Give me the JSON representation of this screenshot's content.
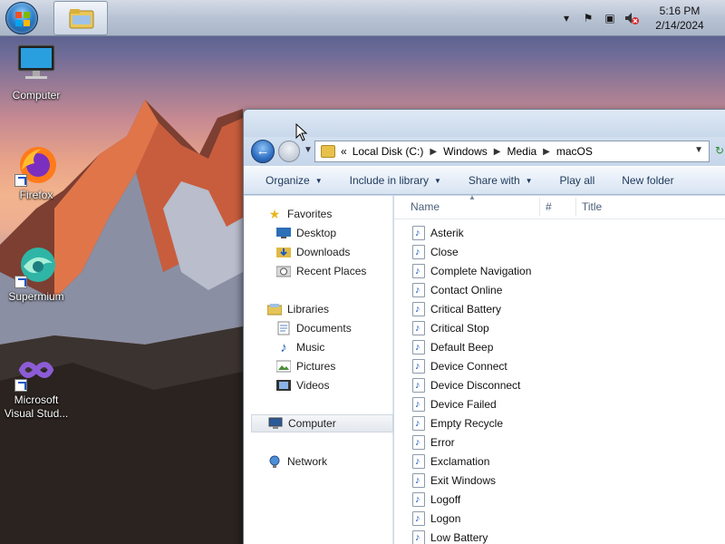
{
  "taskbar": {
    "clock_time": "5:16 PM",
    "clock_date": "2/14/2024",
    "tray_icons": [
      "chevron-up-icon",
      "action-center-flag-icon",
      "network-icon",
      "volume-muted-icon"
    ]
  },
  "desktop": {
    "icons": [
      {
        "label": "Computer",
        "icon": "computer-icon"
      },
      {
        "label": "Firefox",
        "icon": "firefox-icon"
      },
      {
        "label": "Supermium",
        "icon": "supermium-icon"
      },
      {
        "label": "Microsoft Visual Stud...",
        "icon": "visual-studio-icon"
      }
    ]
  },
  "explorer": {
    "address": {
      "prefix": "«",
      "crumbs": [
        "Local Disk (C:)",
        "Windows",
        "Media",
        "macOS"
      ]
    },
    "toolbar": {
      "organize": "Organize",
      "include": "Include in library",
      "share": "Share with",
      "play_all": "Play all",
      "new_folder": "New folder"
    },
    "nav": {
      "favorites": "Favorites",
      "desktop": "Desktop",
      "downloads": "Downloads",
      "recent": "Recent Places",
      "libraries": "Libraries",
      "documents": "Documents",
      "music": "Music",
      "pictures": "Pictures",
      "videos": "Videos",
      "computer": "Computer",
      "network": "Network"
    },
    "columns": {
      "name": "Name",
      "number": "#",
      "title": "Title"
    },
    "files": [
      "Asterik",
      "Close",
      "Complete Navigation",
      "Contact Online",
      "Critical Battery",
      "Critical Stop",
      "Default Beep",
      "Device Connect",
      "Device Disconnect",
      "Device Failed",
      "Empty Recycle",
      "Error",
      "Exclamation",
      "Exit Windows",
      "Logoff",
      "Logon",
      "Low Battery"
    ]
  },
  "colors": {
    "accent": "#1e395b",
    "selection": "#e3e8ee",
    "taskbar": "#b8c3d3"
  }
}
